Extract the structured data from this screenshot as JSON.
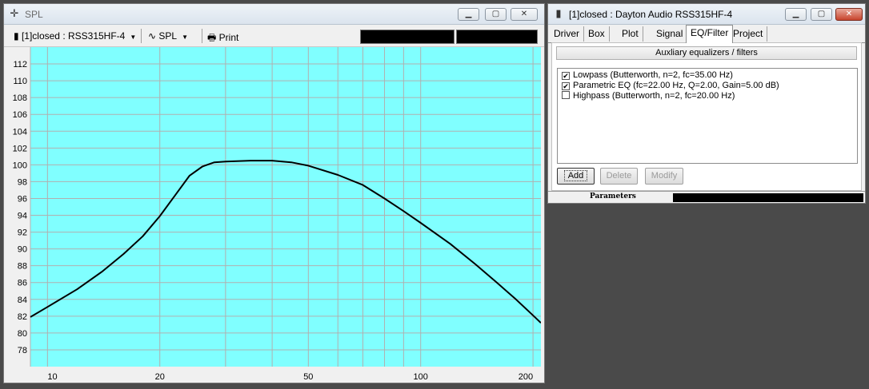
{
  "spl_window": {
    "title": "SPL",
    "icon": "crosshair-icon",
    "toolbar": {
      "project_select": "[1]closed : RSS315HF-4",
      "view_select": "SPL",
      "print_label": "Print"
    }
  },
  "eq_window": {
    "title": "[1]closed : Dayton Audio RSS315HF-4",
    "tabs": [
      "Driver",
      "Box",
      "Plot",
      "Signal",
      "EQ/Filter",
      "Project"
    ],
    "active_tab": "EQ/Filter",
    "aux_button": "Auxliary equalizers / filters",
    "filters": [
      {
        "label": "Lowpass (Butterworth, n=2, fc=35.00 Hz)",
        "checked": true
      },
      {
        "label": "Parametric EQ (fc=22.00 Hz, Q=2.00, Gain=5.00 dB)",
        "checked": true
      },
      {
        "label": "Highpass (Butterworth, n=2, fc=20.00 Hz)",
        "checked": false
      }
    ],
    "buttons": {
      "add": "Add",
      "delete": "Delete",
      "modify": "Modify"
    },
    "status_label": "Parameters"
  },
  "chart_data": {
    "type": "line",
    "xscale": "log",
    "xlim": [
      9,
      210
    ],
    "ylim": [
      76,
      114
    ],
    "x_ticks": [
      10,
      20,
      50,
      100,
      200
    ],
    "y_ticks": [
      78,
      80,
      82,
      84,
      86,
      88,
      90,
      92,
      94,
      96,
      98,
      100,
      102,
      104,
      106,
      108,
      110,
      112
    ],
    "grid": true,
    "background": "#80ffff",
    "grid_color": "#b0b0b0",
    "line_color": "#000000",
    "series": [
      {
        "x": [
          9,
          10,
          12,
          14,
          16,
          18,
          20,
          22,
          24,
          26,
          28,
          30,
          35,
          40,
          45,
          50,
          60,
          70,
          80,
          90,
          100,
          120,
          140,
          160,
          180,
          200,
          210
        ],
        "y": [
          81.9,
          83.1,
          85.2,
          87.3,
          89.4,
          91.5,
          93.9,
          96.4,
          98.7,
          99.8,
          100.3,
          100.4,
          100.5,
          100.5,
          100.3,
          99.9,
          98.8,
          97.6,
          96.0,
          94.5,
          93.1,
          90.6,
          88.2,
          86.0,
          84.0,
          82.1,
          81.2
        ]
      }
    ]
  }
}
